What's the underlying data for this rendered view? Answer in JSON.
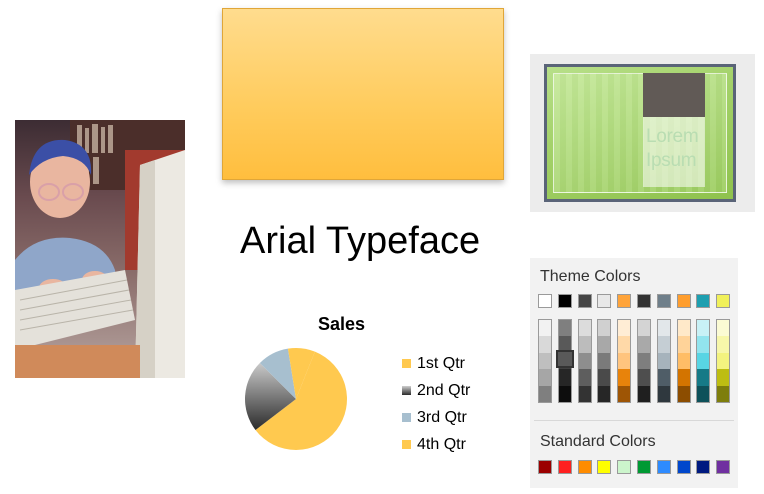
{
  "typeface_sample": "Arial Typeface",
  "thumbnail": {
    "text_line1": "Lorem",
    "text_line2": "Ipsum"
  },
  "chart_data": {
    "type": "pie",
    "title": "Sales",
    "categories": [
      "1st Qtr",
      "2nd Qtr",
      "3rd Qtr",
      "4th Qtr"
    ],
    "values": [
      8.2,
      3.2,
      1.4,
      1.2
    ],
    "colors": [
      "#ffc94f",
      "#4a4a4a",
      "#a7bfcf",
      "#ffc94f"
    ],
    "legend_position": "right"
  },
  "color_picker": {
    "theme_heading": "Theme Colors",
    "standard_heading": "Standard Colors",
    "theme_top_row": [
      "#ffffff",
      "#000000",
      "#454545",
      "#e8e8e8",
      "#ffa43a",
      "#333333",
      "#6f7f8a",
      "#ff9e2e",
      "#1e9fb0",
      "#f0f05a"
    ],
    "theme_columns": [
      [
        "#f2f2f2",
        "#d9d9d9",
        "#bfbfbf",
        "#a6a6a6",
        "#7f7f7f"
      ],
      [
        "#7f7f7f",
        "#595959",
        "#404040",
        "#262626",
        "#0d0d0d"
      ],
      [
        "#dcdcdc",
        "#bcbcbc",
        "#8e8e8e",
        "#5e5e5e",
        "#333333"
      ],
      [
        "#d0d0d0",
        "#a8a8a8",
        "#7a7a7a",
        "#4a4a4a",
        "#262626"
      ],
      [
        "#ffedd5",
        "#ffd9a8",
        "#ffc47e",
        "#e8830b",
        "#9e5505"
      ],
      [
        "#d4d4d4",
        "#a9a9a9",
        "#7e7e7e",
        "#4e4e4e",
        "#1f1f1f"
      ],
      [
        "#e2e7ea",
        "#c5ced4",
        "#a6b3bc",
        "#4f5d67",
        "#2f383e"
      ],
      [
        "#ffe9c9",
        "#ffd399",
        "#ffbd66",
        "#d37400",
        "#8c4d00"
      ],
      [
        "#c8f1f6",
        "#92e4ee",
        "#58d5e4",
        "#167a87",
        "#0e515a"
      ],
      [
        "#fbfbd4",
        "#f7f7aa",
        "#f3f37f",
        "#bdbd12",
        "#7e7e0c"
      ]
    ],
    "standard_colors": [
      "#9b0000",
      "#ff2020",
      "#ff8c00",
      "#ffff00",
      "#ccf5cc",
      "#009933",
      "#2e8bff",
      "#0047cc",
      "#001a80",
      "#7030a0"
    ]
  }
}
